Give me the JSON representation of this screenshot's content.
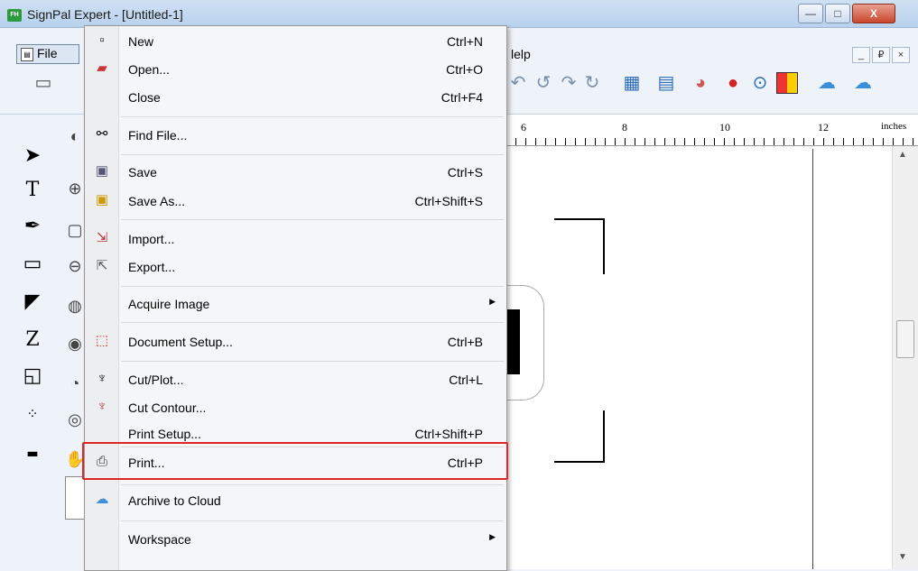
{
  "window": {
    "title": "SignPal Expert - [Untitled-1]",
    "logo_text": "FH",
    "min": "—",
    "max": "□",
    "close": "X"
  },
  "menubar": {
    "file": "File",
    "help": "lelp",
    "mdi_min": "_",
    "mdi_restore": "₽",
    "mdi_close": "×"
  },
  "ruler": {
    "numbers": [
      "6",
      "8",
      "10",
      "12"
    ],
    "unit": "inches"
  },
  "file_menu": [
    {
      "label": "New",
      "shortcut": "Ctrl+N",
      "icon": "new-document-icon"
    },
    {
      "label": "Open...",
      "shortcut": "Ctrl+O",
      "icon": "open-icon"
    },
    {
      "label": "Close",
      "shortcut": "Ctrl+F4",
      "icon": ""
    },
    {
      "label": "Find File...",
      "shortcut": "",
      "icon": "binoculars-icon"
    },
    {
      "label": "Save",
      "shortcut": "Ctrl+S",
      "icon": "save-icon"
    },
    {
      "label": "Save As...",
      "shortcut": "Ctrl+Shift+S",
      "icon": "save-as-icon"
    },
    {
      "label": "Import...",
      "shortcut": "",
      "icon": "import-icon"
    },
    {
      "label": "Export...",
      "shortcut": "",
      "icon": "export-icon"
    },
    {
      "label": "Acquire Image",
      "shortcut": "",
      "icon": "",
      "submenu": true
    },
    {
      "label": "Document Setup...",
      "shortcut": "Ctrl+B",
      "icon": "document-setup-icon"
    },
    {
      "label": "Cut/Plot...",
      "shortcut": "Ctrl+L",
      "icon": "plotter-icon"
    },
    {
      "label": "Cut Contour...",
      "shortcut": "",
      "icon": "cut-contour-icon"
    },
    {
      "label": "Print Setup...",
      "shortcut": "Ctrl+Shift+P",
      "icon": ""
    },
    {
      "label": "Print...",
      "shortcut": "Ctrl+P",
      "icon": "printer-icon",
      "highlighted": true
    },
    {
      "label": "Archive to Cloud",
      "shortcut": "",
      "icon": "cloud-icon"
    },
    {
      "label": "Workspace",
      "shortcut": "",
      "icon": "",
      "submenu": true
    }
  ],
  "colors": {
    "highlight_border": "#e0252a",
    "menu_bg": "#f5f6f7",
    "window_bg": "#eef3f9"
  }
}
